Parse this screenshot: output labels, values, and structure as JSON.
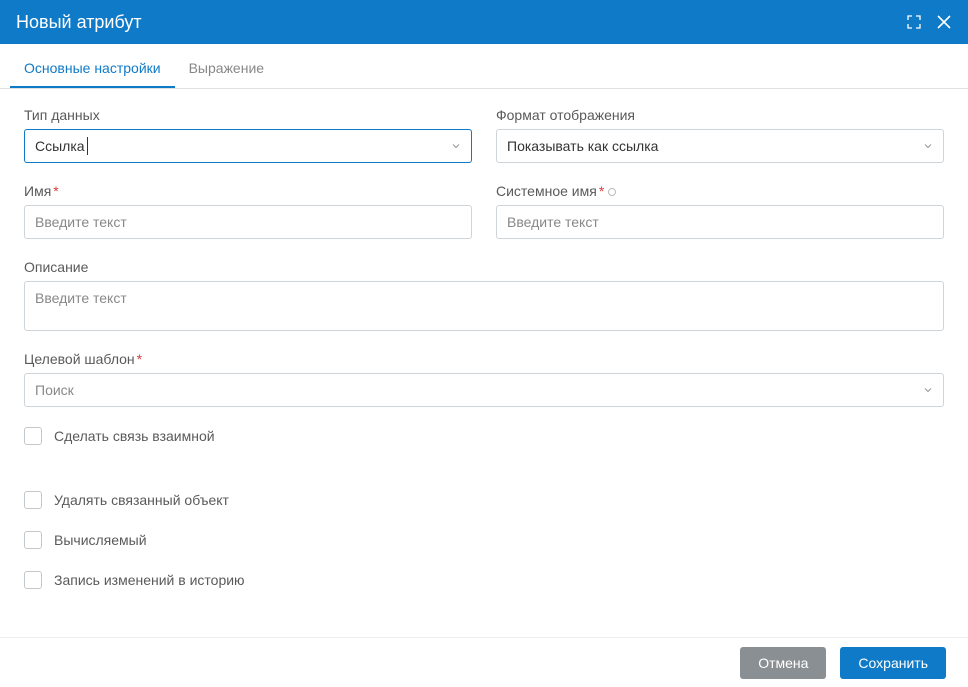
{
  "header": {
    "title": "Новый атрибут"
  },
  "tabs": {
    "main": "Основные настройки",
    "expression": "Выражение"
  },
  "fields": {
    "dataType": {
      "label": "Тип данных",
      "value": "Ссылка"
    },
    "displayFormat": {
      "label": "Формат отображения",
      "value": "Показывать как ссылка"
    },
    "name": {
      "label": "Имя",
      "placeholder": "Введите текст"
    },
    "systemName": {
      "label": "Системное имя",
      "placeholder": "Введите текст"
    },
    "description": {
      "label": "Описание",
      "placeholder": "Введите текст"
    },
    "targetTemplate": {
      "label": "Целевой шаблон",
      "placeholder": "Поиск"
    }
  },
  "checkboxes": {
    "mutual": "Сделать связь взаимной",
    "deleteLinked": "Удалять связанный объект",
    "computed": "Вычисляемый",
    "history": "Запись изменений в историю"
  },
  "footer": {
    "cancel": "Отмена",
    "save": "Сохранить"
  }
}
